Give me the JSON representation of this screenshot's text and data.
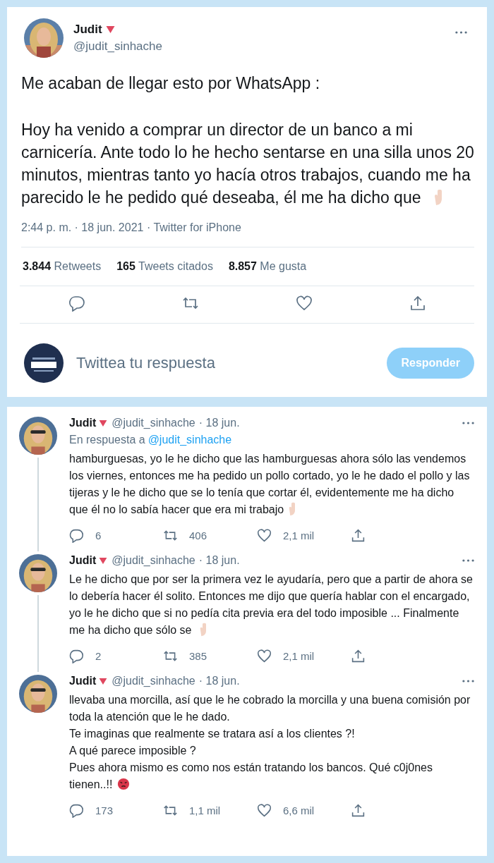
{
  "tweet": {
    "name": "Judit",
    "handle": "@judit_sinhache",
    "paragraphs": [
      [
        {
          "kind": "text",
          "text": "Me acaban de llegar esto por WhatsApp :"
        }
      ],
      [
        {
          "kind": "text",
          "text": "Hoy ha venido a comprar un director de un banco a mi carnicería. Ante todo lo he hecho sentarse en una silla unos 20 minutos, mientras tanto yo hacía otros trabajos, cuando me ha parecido le he pedido qué deseaba, él me ha dicho que "
        },
        {
          "kind": "hand"
        }
      ]
    ],
    "meta": "2:44 p. m. · 18 jun. 2021 · Twitter for iPhone",
    "stats": [
      {
        "count": "3.844",
        "label": "Retweets"
      },
      {
        "count": "165",
        "label": "Tweets citados"
      },
      {
        "count": "8.857",
        "label": "Me gusta"
      }
    ],
    "actions": [
      {
        "kind": "reply"
      },
      {
        "kind": "retweet"
      },
      {
        "kind": "like"
      },
      {
        "kind": "share"
      }
    ]
  },
  "compose": {
    "placeholder": "Twittea tu respuesta",
    "button": "Responder",
    "disabled": true
  },
  "replies": [
    {
      "name": "Judit",
      "handle": "@judit_sinhache",
      "date": "· 18 jun.",
      "in_reply_label": "En respuesta a",
      "in_reply_to": "@judit_sinhache",
      "paragraphs": [
        [
          {
            "kind": "text",
            "text": "hamburguesas, yo le he dicho que las hamburguesas ahora sólo las vendemos los viernes, entonces me ha pedido un pollo cortado, yo le he dado el pollo y las tijeras y le he dicho que se lo tenía que cortar él, evidentemente me ha dicho que él no lo sabía hacer que era mi trabajo"
          },
          {
            "kind": "hand"
          }
        ]
      ],
      "actions": [
        {
          "kind": "reply",
          "count": "6"
        },
        {
          "kind": "retweet",
          "count": "406"
        },
        {
          "kind": "like",
          "count": "2,1 mil"
        },
        {
          "kind": "share"
        }
      ]
    },
    {
      "name": "Judit",
      "handle": "@judit_sinhache",
      "date": "· 18 jun.",
      "paragraphs": [
        [
          {
            "kind": "text",
            "text": "Le he dicho que por ser la primera vez le ayudaría, pero que a partir de ahora se lo debería hacer él solito. Entonces me dijo que quería hablar con el encargado, yo le he dicho que si no pedía cita previa era del todo imposible ... Finalmente me ha dicho que sólo se "
          },
          {
            "kind": "hand"
          }
        ]
      ],
      "actions": [
        {
          "kind": "reply",
          "count": "2"
        },
        {
          "kind": "retweet",
          "count": "385"
        },
        {
          "kind": "like",
          "count": "2,1 mil"
        },
        {
          "kind": "share"
        }
      ]
    },
    {
      "name": "Judit",
      "handle": "@judit_sinhache",
      "date": "· 18 jun.",
      "paragraphs": [
        [
          {
            "kind": "text",
            "text": "llevaba una morcilla, así que le he cobrado la morcilla y una buena comisión por toda la atención que le he dado."
          }
        ],
        [
          {
            "kind": "text",
            "text": "Te imaginas que realmente se tratara así a los clientes ?!"
          }
        ],
        [
          {
            "kind": "text",
            "text": "A qué parece imposible ?"
          }
        ],
        [
          {
            "kind": "text",
            "text": "Pues ahora mismo es como nos están tratando los bancos. Qué c0j0nes tienen..!! "
          },
          {
            "kind": "angry"
          }
        ]
      ],
      "actions": [
        {
          "kind": "reply",
          "count": "173"
        },
        {
          "kind": "retweet",
          "count": "1,1 mil"
        },
        {
          "kind": "like",
          "count": "6,6 mil"
        },
        {
          "kind": "share"
        }
      ]
    }
  ]
}
